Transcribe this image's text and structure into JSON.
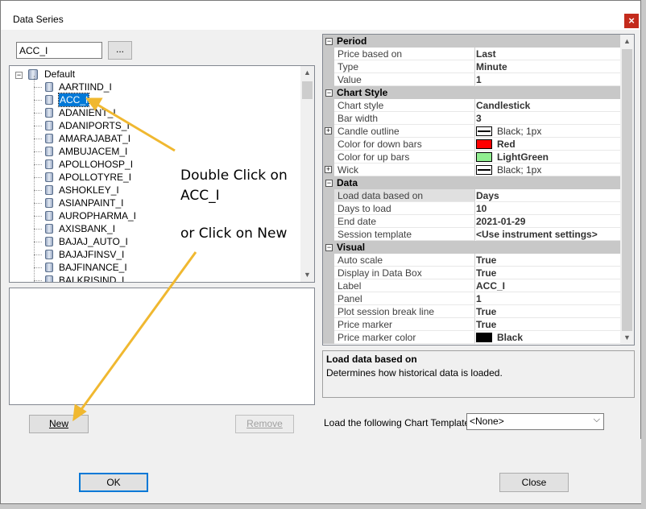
{
  "window": {
    "title": "Data Series",
    "close_glyph": "×"
  },
  "search": {
    "value": "ACC_I",
    "browse_label": "..."
  },
  "tree": {
    "root_label": "Default",
    "items": [
      {
        "label": "AARTIIND_I"
      },
      {
        "label": "ACC_I",
        "selected": true
      },
      {
        "label": "ADANIENT_I"
      },
      {
        "label": "ADANIPORTS_I"
      },
      {
        "label": "AMARAJABAT_I"
      },
      {
        "label": "AMBUJACEM_I"
      },
      {
        "label": "APOLLOHOSP_I"
      },
      {
        "label": "APOLLOTYRE_I"
      },
      {
        "label": "ASHOKLEY_I"
      },
      {
        "label": "ASIANPAINT_I"
      },
      {
        "label": "AUROPHARMA_I"
      },
      {
        "label": "AXISBANK_I"
      },
      {
        "label": "BAJAJ_AUTO_I"
      },
      {
        "label": "BAJAJFINSV_I"
      },
      {
        "label": "BAJFINANCE_I"
      },
      {
        "label": "BALKRISIND_I"
      }
    ]
  },
  "buttons": {
    "new": "New",
    "remove": "Remove",
    "ok": "OK",
    "close": "Close"
  },
  "properties": {
    "period": {
      "title": "Period",
      "rows": [
        {
          "name": "Price based on",
          "value": "Last"
        },
        {
          "name": "Type",
          "value": "Minute"
        },
        {
          "name": "Value",
          "value": "1"
        }
      ]
    },
    "chart_style": {
      "title": "Chart Style",
      "rows": [
        {
          "name": "Chart style",
          "value": "Candlestick"
        },
        {
          "name": "Bar width",
          "value": "3"
        },
        {
          "name": "Candle outline",
          "value": "Black; 1px"
        },
        {
          "name": "Color for down bars",
          "value": "Red"
        },
        {
          "name": "Color for up bars",
          "value": "LightGreen"
        },
        {
          "name": "Wick",
          "value": "Black; 1px"
        }
      ]
    },
    "data": {
      "title": "Data",
      "rows": [
        {
          "name": "Load data based on",
          "value": "Days"
        },
        {
          "name": "Days to load",
          "value": "10"
        },
        {
          "name": "End date",
          "value": "2021-01-29"
        },
        {
          "name": "Session template",
          "value": "<Use instrument settings>"
        }
      ]
    },
    "visual": {
      "title": "Visual",
      "rows": [
        {
          "name": "Auto scale",
          "value": "True"
        },
        {
          "name": "Display in Data Box",
          "value": "True"
        },
        {
          "name": "Label",
          "value": "ACC_I"
        },
        {
          "name": "Panel",
          "value": "1"
        },
        {
          "name": "Plot session break line",
          "value": "True"
        },
        {
          "name": "Price marker",
          "value": "True"
        },
        {
          "name": "Price marker color",
          "value": "Black"
        }
      ]
    }
  },
  "colors": {
    "red": "#ff0000",
    "lightgreen": "#90ee90",
    "black": "#000000",
    "selection": "#0078d7",
    "annotation_arrow": "#f0b830"
  },
  "description": {
    "title": "Load data based on",
    "text": "Determines how historical data is loaded."
  },
  "template": {
    "label": "Load the following Chart Template:",
    "value": "<None>"
  },
  "annotations": {
    "line1": "Double Click on",
    "line2": "ACC_I",
    "line3": "or Click on New"
  }
}
